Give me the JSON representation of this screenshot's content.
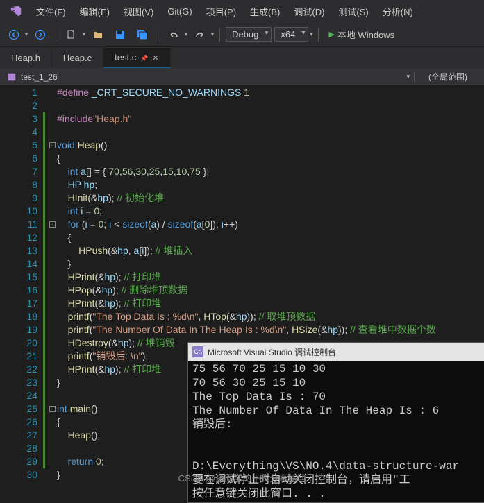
{
  "menubar": {
    "items": [
      "文件(F)",
      "编辑(E)",
      "视图(V)",
      "Git(G)",
      "项目(P)",
      "生成(B)",
      "调试(D)",
      "测试(S)",
      "分析(N)"
    ]
  },
  "toolbar": {
    "config": "Debug",
    "platform": "x64",
    "run_label": "本地 Windows"
  },
  "tabs": [
    {
      "label": "Heap.h",
      "active": false
    },
    {
      "label": "Heap.c",
      "active": false
    },
    {
      "label": "test.c",
      "active": true
    }
  ],
  "nav": {
    "scope": "test_1_26",
    "global": "(全局范围)"
  },
  "code": {
    "lines": [
      {
        "n": 1,
        "m": false,
        "f": "",
        "tokens": [
          {
            "c": "mac",
            "t": "#define"
          },
          {
            "c": "op",
            "t": " "
          },
          {
            "c": "var",
            "t": "_CRT_SECURE_NO_WARNINGS"
          },
          {
            "c": "op",
            "t": " "
          },
          {
            "c": "num",
            "t": "1"
          }
        ]
      },
      {
        "n": 2,
        "m": false,
        "f": "",
        "tokens": []
      },
      {
        "n": 3,
        "m": true,
        "f": "",
        "tokens": [
          {
            "c": "mac",
            "t": "#include"
          },
          {
            "c": "str",
            "t": "\"Heap.h\""
          }
        ]
      },
      {
        "n": 4,
        "m": true,
        "f": "",
        "tokens": []
      },
      {
        "n": 5,
        "m": true,
        "f": "-",
        "tokens": [
          {
            "c": "kw",
            "t": "void"
          },
          {
            "c": "op",
            "t": " "
          },
          {
            "c": "fn",
            "t": "Heap"
          },
          {
            "c": "op",
            "t": "()"
          }
        ]
      },
      {
        "n": 6,
        "m": true,
        "f": "",
        "tokens": [
          {
            "c": "op",
            "t": "{"
          }
        ]
      },
      {
        "n": 7,
        "m": true,
        "f": "",
        "tokens": [
          {
            "c": "op",
            "t": "    "
          },
          {
            "c": "kw",
            "t": "int"
          },
          {
            "c": "op",
            "t": " "
          },
          {
            "c": "var",
            "t": "a"
          },
          {
            "c": "op",
            "t": "[] = { "
          },
          {
            "c": "num",
            "t": "70"
          },
          {
            "c": "op",
            "t": ","
          },
          {
            "c": "num",
            "t": "56"
          },
          {
            "c": "op",
            "t": ","
          },
          {
            "c": "num",
            "t": "30"
          },
          {
            "c": "op",
            "t": ","
          },
          {
            "c": "num",
            "t": "25"
          },
          {
            "c": "op",
            "t": ","
          },
          {
            "c": "num",
            "t": "15"
          },
          {
            "c": "op",
            "t": ","
          },
          {
            "c": "num",
            "t": "10"
          },
          {
            "c": "op",
            "t": ","
          },
          {
            "c": "num",
            "t": "75"
          },
          {
            "c": "op",
            "t": " };"
          }
        ]
      },
      {
        "n": 8,
        "m": true,
        "f": "",
        "tokens": [
          {
            "c": "op",
            "t": "    "
          },
          {
            "c": "var",
            "t": "HP"
          },
          {
            "c": "op",
            "t": " "
          },
          {
            "c": "var",
            "t": "hp"
          },
          {
            "c": "op",
            "t": ";"
          }
        ]
      },
      {
        "n": 9,
        "m": true,
        "f": "",
        "tokens": [
          {
            "c": "op",
            "t": "    "
          },
          {
            "c": "fn",
            "t": "HInit"
          },
          {
            "c": "op",
            "t": "(&"
          },
          {
            "c": "var",
            "t": "hp"
          },
          {
            "c": "op",
            "t": "); "
          },
          {
            "c": "cmt",
            "t": "// 初始化堆"
          }
        ]
      },
      {
        "n": 10,
        "m": true,
        "f": "",
        "tokens": [
          {
            "c": "op",
            "t": "    "
          },
          {
            "c": "kw",
            "t": "int"
          },
          {
            "c": "op",
            "t": " "
          },
          {
            "c": "var",
            "t": "i"
          },
          {
            "c": "op",
            "t": " = "
          },
          {
            "c": "num",
            "t": "0"
          },
          {
            "c": "op",
            "t": ";"
          }
        ]
      },
      {
        "n": 11,
        "m": true,
        "f": "-",
        "tokens": [
          {
            "c": "op",
            "t": "    "
          },
          {
            "c": "kw",
            "t": "for"
          },
          {
            "c": "op",
            "t": " ("
          },
          {
            "c": "var",
            "t": "i"
          },
          {
            "c": "op",
            "t": " = "
          },
          {
            "c": "num",
            "t": "0"
          },
          {
            "c": "op",
            "t": "; "
          },
          {
            "c": "var",
            "t": "i"
          },
          {
            "c": "op",
            "t": " < "
          },
          {
            "c": "kw",
            "t": "sizeof"
          },
          {
            "c": "op",
            "t": "("
          },
          {
            "c": "var",
            "t": "a"
          },
          {
            "c": "op",
            "t": ") / "
          },
          {
            "c": "kw",
            "t": "sizeof"
          },
          {
            "c": "op",
            "t": "("
          },
          {
            "c": "var",
            "t": "a"
          },
          {
            "c": "op",
            "t": "["
          },
          {
            "c": "num",
            "t": "0"
          },
          {
            "c": "op",
            "t": "]); "
          },
          {
            "c": "var",
            "t": "i"
          },
          {
            "c": "op",
            "t": "++)"
          }
        ]
      },
      {
        "n": 12,
        "m": true,
        "f": "",
        "tokens": [
          {
            "c": "op",
            "t": "    {"
          }
        ]
      },
      {
        "n": 13,
        "m": true,
        "f": "",
        "tokens": [
          {
            "c": "op",
            "t": "        "
          },
          {
            "c": "fn",
            "t": "HPush"
          },
          {
            "c": "op",
            "t": "(&"
          },
          {
            "c": "var",
            "t": "hp"
          },
          {
            "c": "op",
            "t": ", "
          },
          {
            "c": "var",
            "t": "a"
          },
          {
            "c": "op",
            "t": "["
          },
          {
            "c": "var",
            "t": "i"
          },
          {
            "c": "op",
            "t": "]); "
          },
          {
            "c": "cmt",
            "t": "// 堆插入"
          }
        ]
      },
      {
        "n": 14,
        "m": true,
        "f": "",
        "tokens": [
          {
            "c": "op",
            "t": "    }"
          }
        ]
      },
      {
        "n": 15,
        "m": true,
        "f": "",
        "tokens": [
          {
            "c": "op",
            "t": "    "
          },
          {
            "c": "fn",
            "t": "HPrint"
          },
          {
            "c": "op",
            "t": "(&"
          },
          {
            "c": "var",
            "t": "hp"
          },
          {
            "c": "op",
            "t": "); "
          },
          {
            "c": "cmt",
            "t": "// 打印堆"
          }
        ]
      },
      {
        "n": 16,
        "m": true,
        "f": "",
        "tokens": [
          {
            "c": "op",
            "t": "    "
          },
          {
            "c": "fn",
            "t": "HPop"
          },
          {
            "c": "op",
            "t": "(&"
          },
          {
            "c": "var",
            "t": "hp"
          },
          {
            "c": "op",
            "t": "); "
          },
          {
            "c": "cmt",
            "t": "// 删除堆顶数据"
          }
        ]
      },
      {
        "n": 17,
        "m": true,
        "f": "",
        "tokens": [
          {
            "c": "op",
            "t": "    "
          },
          {
            "c": "fn",
            "t": "HPrint"
          },
          {
            "c": "op",
            "t": "(&"
          },
          {
            "c": "var",
            "t": "hp"
          },
          {
            "c": "op",
            "t": "); "
          },
          {
            "c": "cmt",
            "t": "// 打印堆"
          }
        ]
      },
      {
        "n": 18,
        "m": true,
        "f": "",
        "tokens": [
          {
            "c": "op",
            "t": "    "
          },
          {
            "c": "fn",
            "t": "printf"
          },
          {
            "c": "op",
            "t": "("
          },
          {
            "c": "str-b",
            "t": "\"The Top Data Is : %d\\n\""
          },
          {
            "c": "op",
            "t": ", "
          },
          {
            "c": "fn",
            "t": "HTop"
          },
          {
            "c": "op",
            "t": "(&"
          },
          {
            "c": "var",
            "t": "hp"
          },
          {
            "c": "op",
            "t": ")); "
          },
          {
            "c": "cmt",
            "t": "// 取堆顶数据"
          }
        ]
      },
      {
        "n": 19,
        "m": true,
        "f": "",
        "tokens": [
          {
            "c": "op",
            "t": "    "
          },
          {
            "c": "fn",
            "t": "printf"
          },
          {
            "c": "op",
            "t": "("
          },
          {
            "c": "str-b",
            "t": "\"The Number Of Data In The Heap Is : %d\\n\""
          },
          {
            "c": "op",
            "t": ", "
          },
          {
            "c": "fn",
            "t": "HSize"
          },
          {
            "c": "op",
            "t": "(&"
          },
          {
            "c": "var",
            "t": "hp"
          },
          {
            "c": "op",
            "t": ")); "
          },
          {
            "c": "cmt",
            "t": "// 查看堆中数据个数"
          }
        ]
      },
      {
        "n": 20,
        "m": true,
        "f": "",
        "tokens": [
          {
            "c": "op",
            "t": "    "
          },
          {
            "c": "fn",
            "t": "HDestroy"
          },
          {
            "c": "op",
            "t": "(&"
          },
          {
            "c": "var",
            "t": "hp"
          },
          {
            "c": "op",
            "t": "); "
          },
          {
            "c": "cmt",
            "t": "// 堆销毁"
          }
        ]
      },
      {
        "n": 21,
        "m": true,
        "f": "",
        "tokens": [
          {
            "c": "op",
            "t": "    "
          },
          {
            "c": "fn",
            "t": "printf"
          },
          {
            "c": "op",
            "t": "("
          },
          {
            "c": "str-b",
            "t": "\"销毁后: \\n\""
          },
          {
            "c": "op",
            "t": ");"
          }
        ]
      },
      {
        "n": 22,
        "m": true,
        "f": "",
        "tokens": [
          {
            "c": "op",
            "t": "    "
          },
          {
            "c": "fn",
            "t": "HPrint"
          },
          {
            "c": "op",
            "t": "(&"
          },
          {
            "c": "var",
            "t": "hp"
          },
          {
            "c": "op",
            "t": "); "
          },
          {
            "c": "cmt",
            "t": "// 打印堆"
          }
        ]
      },
      {
        "n": 23,
        "m": true,
        "f": "",
        "tokens": [
          {
            "c": "op",
            "t": "}"
          }
        ]
      },
      {
        "n": 24,
        "m": true,
        "f": "",
        "tokens": []
      },
      {
        "n": 25,
        "m": true,
        "f": "-",
        "tokens": [
          {
            "c": "kw",
            "t": "int"
          },
          {
            "c": "op",
            "t": " "
          },
          {
            "c": "fn",
            "t": "main"
          },
          {
            "c": "op",
            "t": "()"
          }
        ]
      },
      {
        "n": 26,
        "m": true,
        "f": "",
        "tokens": [
          {
            "c": "op",
            "t": "{"
          }
        ]
      },
      {
        "n": 27,
        "m": true,
        "f": "",
        "tokens": [
          {
            "c": "op",
            "t": "    "
          },
          {
            "c": "fn",
            "t": "Heap"
          },
          {
            "c": "op",
            "t": "();"
          }
        ]
      },
      {
        "n": 28,
        "m": true,
        "f": "",
        "tokens": []
      },
      {
        "n": 29,
        "m": true,
        "f": "",
        "tokens": [
          {
            "c": "op",
            "t": "    "
          },
          {
            "c": "kw",
            "t": "return"
          },
          {
            "c": "op",
            "t": " "
          },
          {
            "c": "num",
            "t": "0"
          },
          {
            "c": "op",
            "t": ";"
          }
        ]
      },
      {
        "n": 30,
        "m": false,
        "f": "",
        "tokens": [
          {
            "c": "op",
            "t": "}"
          }
        ]
      }
    ]
  },
  "console": {
    "title": "Microsoft Visual Studio 调试控制台",
    "icon_text": "C:\\",
    "lines": [
      "75 56 70 25 15 10 30",
      "70 56 30 25 15 10",
      "The Top Data Is : 70",
      "The Number Of Data In The Heap Is : 6",
      "销毁后:",
      "",
      "",
      "D:\\Everything\\VS\\NO.4\\data-structure-war",
      "要在调试停止时自动关闭控制台，请启用\"工",
      "按任意键关闭此窗口. . ."
    ]
  },
  "watermark": "CSDN @銮同学的干货分享基地"
}
